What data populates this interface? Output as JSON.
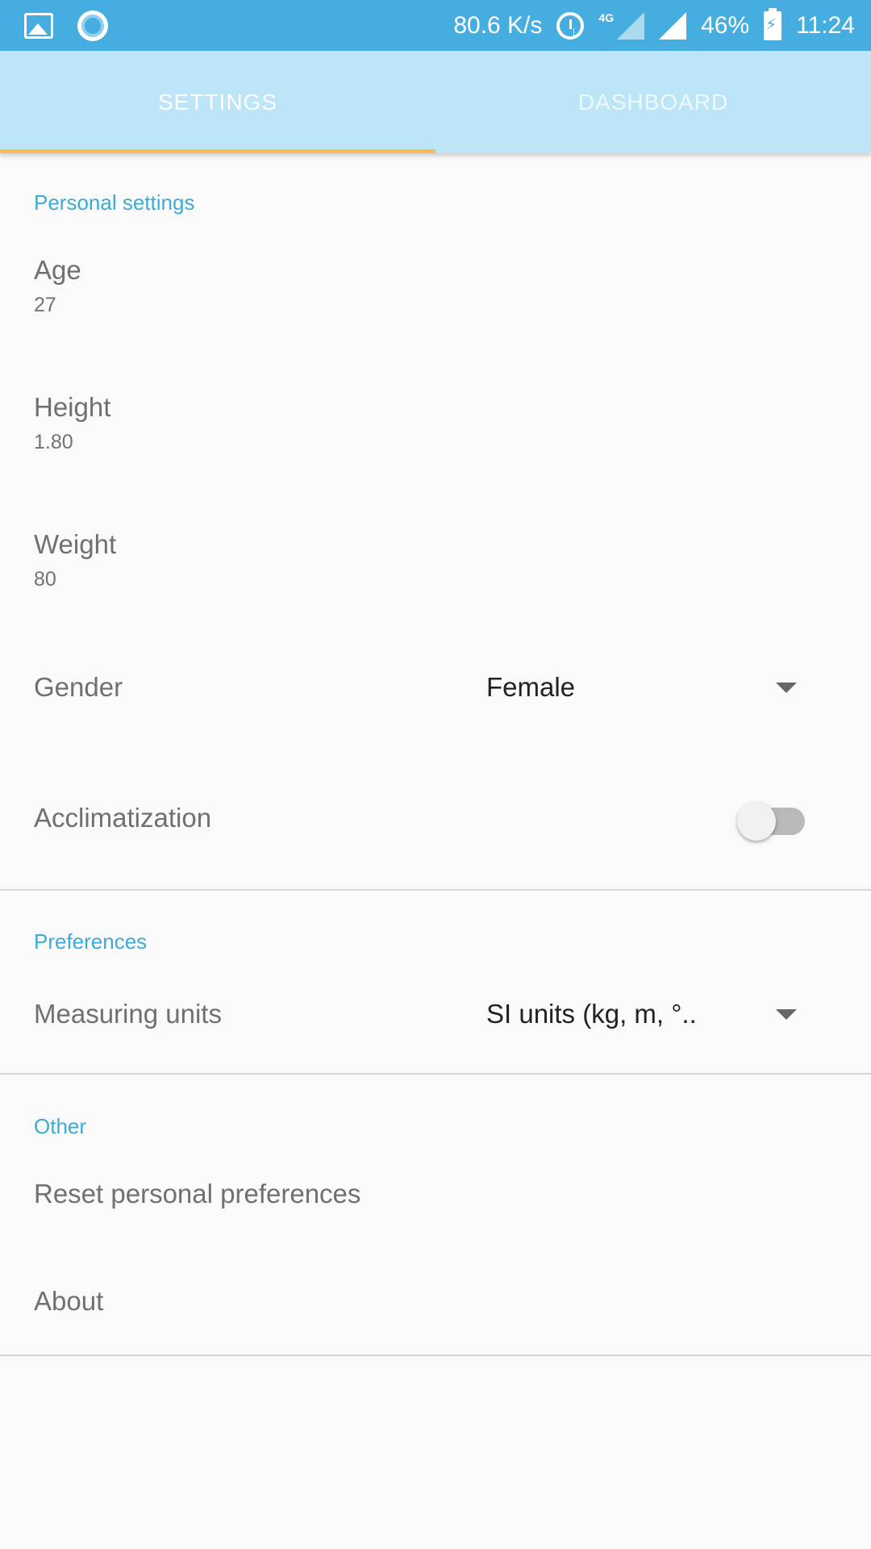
{
  "status_bar": {
    "speed": "80.6 K/s",
    "network": "4G",
    "battery": "46%",
    "time": "11:24",
    "icons": [
      "image-icon",
      "record-icon",
      "alarm-icon",
      "signal-icon",
      "battery-charging-icon"
    ],
    "color": "#45ade0"
  },
  "tabs": [
    {
      "label": "SETTINGS",
      "active": true
    },
    {
      "label": "DASHBOARD",
      "active": false
    }
  ],
  "sections": {
    "personal": {
      "header": "Personal settings",
      "age": {
        "title": "Age",
        "summary": "27"
      },
      "height": {
        "title": "Height",
        "summary": "1.80"
      },
      "weight": {
        "title": "Weight",
        "summary": "80"
      },
      "gender": {
        "title": "Gender",
        "value": "Female"
      },
      "acclimatization": {
        "title": "Acclimatization",
        "enabled": false
      }
    },
    "preferences": {
      "header": "Preferences",
      "units": {
        "title": "Measuring units",
        "value": "SI units (kg, m, °.."
      }
    },
    "other": {
      "header": "Other",
      "reset": {
        "title": "Reset personal preferences"
      },
      "about": {
        "title": "About"
      }
    }
  },
  "colors": {
    "tab_bar": "#bde5f8",
    "tab_indicator": "#f6bf55",
    "section_header": "#3eaad7"
  }
}
